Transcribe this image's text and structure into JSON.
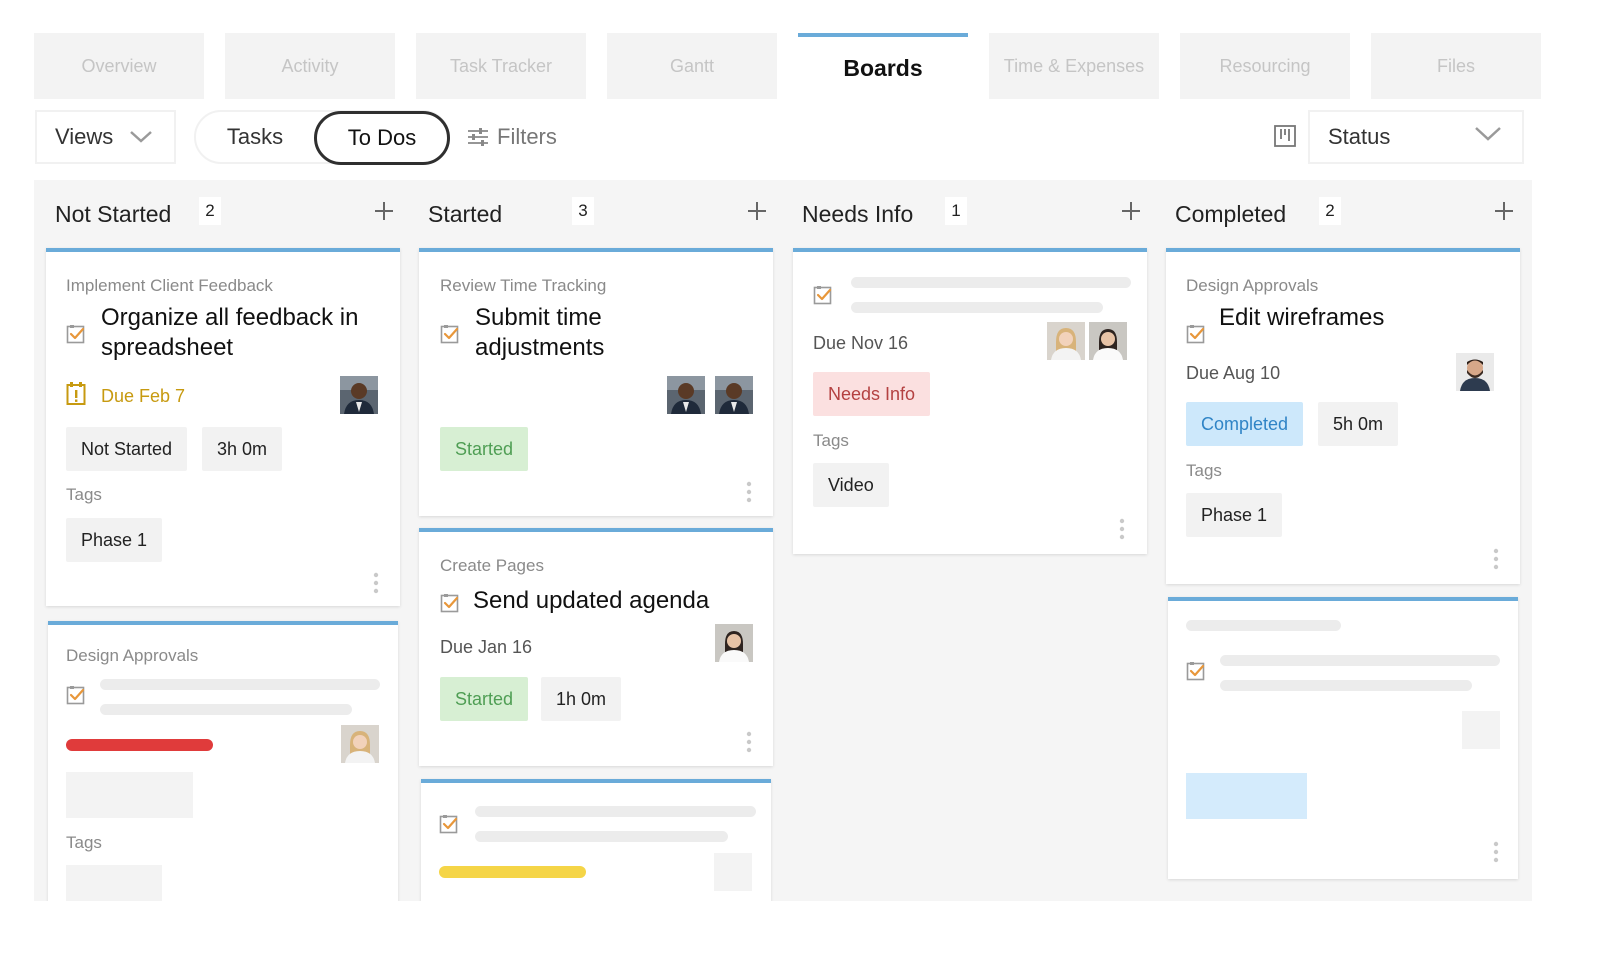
{
  "tabs": [
    "Overview",
    "Activity",
    "Task Tracker",
    "Gantt",
    "Boards",
    "Time & Expenses",
    "Resourcing",
    "Files"
  ],
  "active_tab": "Boards",
  "toolbar": {
    "views_label": "Views",
    "toggle_tasks": "Tasks",
    "toggle_todos": "To Dos",
    "filters_label": "Filters",
    "status_label": "Status"
  },
  "columns": [
    {
      "title": "Not Started",
      "count": "2"
    },
    {
      "title": "Started",
      "count": "3"
    },
    {
      "title": "Needs Info",
      "count": "1"
    },
    {
      "title": "Completed",
      "count": "2"
    }
  ],
  "cards": {
    "ns1": {
      "subtitle": "Implement Client Feedback",
      "title_line1": "Organize all feedback in",
      "title_line2": "spreadsheet",
      "due": "Due Feb 7",
      "status": "Not Started",
      "time": "3h 0m",
      "tags_label": "Tags",
      "tag": "Phase 1"
    },
    "ns2": {
      "subtitle": "Design Approvals",
      "tags_label": "Tags"
    },
    "st1": {
      "subtitle": "Review Time Tracking",
      "title_line1": "Submit time",
      "title_line2": "adjustments",
      "status": "Started"
    },
    "st2": {
      "subtitle": "Create Pages",
      "title": "Send updated agenda",
      "due": "Due Jan 16",
      "status": "Started",
      "time": "1h 0m"
    },
    "ni1": {
      "due": "Due Nov 16",
      "status": "Needs Info",
      "tags_label": "Tags",
      "tag": "Video"
    },
    "co1": {
      "subtitle": "Design Approvals",
      "title": "Edit wireframes",
      "due": "Due Aug 10",
      "status": "Completed",
      "time": "5h 0m",
      "tags_label": "Tags",
      "tag": "Phase 1"
    }
  },
  "colors": {
    "accent": "#6aabd9",
    "started_chip": "#d7efd3",
    "needs_info_chip": "#fbe0e0",
    "completed_chip": "#cde8fb",
    "warning": "#c79a10",
    "red_bar": "#e03b3b",
    "yellow_bar": "#f5d547"
  },
  "icons": [
    "chevron-down-icon",
    "filter-sliders-icon",
    "board-layout-icon",
    "plus-icon",
    "todo-check-icon",
    "warning-calendar-icon",
    "kebab-menu-icon"
  ]
}
